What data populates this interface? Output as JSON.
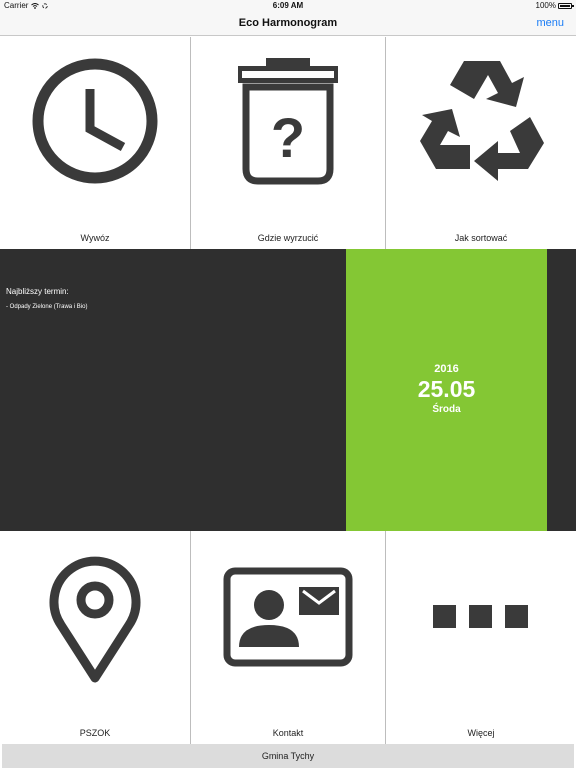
{
  "status_bar": {
    "carrier": "Carrier",
    "time": "6:09 AM",
    "battery": "100%"
  },
  "nav": {
    "title": "Eco Harmonogram",
    "menu": "menu"
  },
  "tiles_top": [
    {
      "label": "Wywóz",
      "icon": "clock-icon"
    },
    {
      "label": "Gdzie wyrzucić",
      "icon": "trash-question-icon"
    },
    {
      "label": "Jak sortować",
      "icon": "recycle-icon"
    }
  ],
  "banner": {
    "heading": "Najbliższy termin:",
    "item": "- Odpady Zielone (Trawa i Bio)",
    "date": {
      "year": "2016",
      "day": "25.05",
      "weekday": "Środa"
    }
  },
  "tiles_bottom": [
    {
      "label": "PSZOK",
      "icon": "map-pin-icon"
    },
    {
      "label": "Kontakt",
      "icon": "contact-card-icon"
    },
    {
      "label": "Więcej",
      "icon": "more-icon"
    }
  ],
  "footer": {
    "text": "Gmina Tychy"
  },
  "colors": {
    "accent": "#84c734",
    "banner_bg": "#2f2f2f",
    "icon": "#3a3a3a",
    "link": "#1a7cf5"
  }
}
